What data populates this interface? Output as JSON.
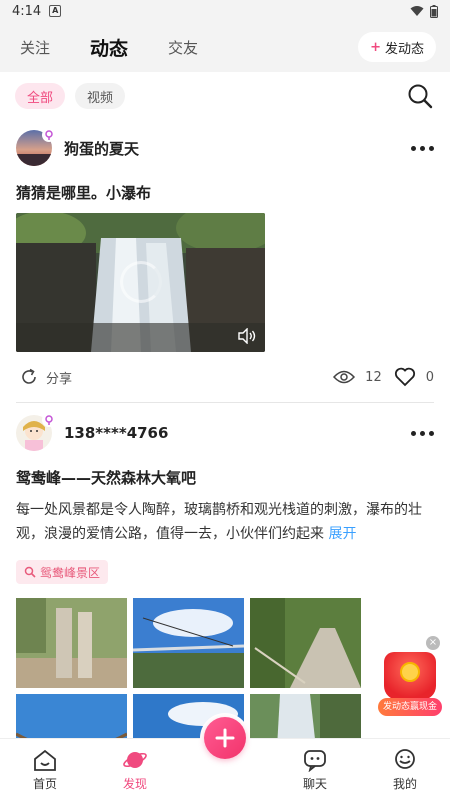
{
  "status_bar": {
    "time": "4:14"
  },
  "top_nav": {
    "tabs": [
      {
        "label": "关注"
      },
      {
        "label": "动态"
      },
      {
        "label": "交友"
      }
    ],
    "post_button": {
      "plus": "+",
      "label": "发动态"
    }
  },
  "filters": [
    {
      "label": "全部",
      "active": true
    },
    {
      "label": "视频",
      "active": false
    }
  ],
  "posts": [
    {
      "username": "狗蛋的夏天",
      "title": "猜猜是哪里。小瀑布",
      "share_label": "分享",
      "views": "12",
      "likes": "0"
    },
    {
      "username": "138****4766",
      "title": "鸳鸯峰——天然森林大氧吧",
      "text": "每一处风景都是令人陶醉，玻璃鹊桥和观光栈道的刺激，瀑布的壮观，浪漫的爱情公路，值得一去，小伙伴们约起来",
      "expand": "展开",
      "location": "鸳鸯峰景区"
    }
  ],
  "promo": {
    "label": "发动态赢现金",
    "close": "×"
  },
  "bottom_nav": [
    {
      "label": "首页",
      "icon": "home-icon"
    },
    {
      "label": "发现",
      "icon": "planet-icon",
      "active": true
    },
    {
      "label": "聊天",
      "icon": "chat-icon"
    },
    {
      "label": "我的",
      "icon": "profile-icon"
    }
  ],
  "colors": {
    "accent": "#f04a7f",
    "link": "#3aa0ff"
  }
}
